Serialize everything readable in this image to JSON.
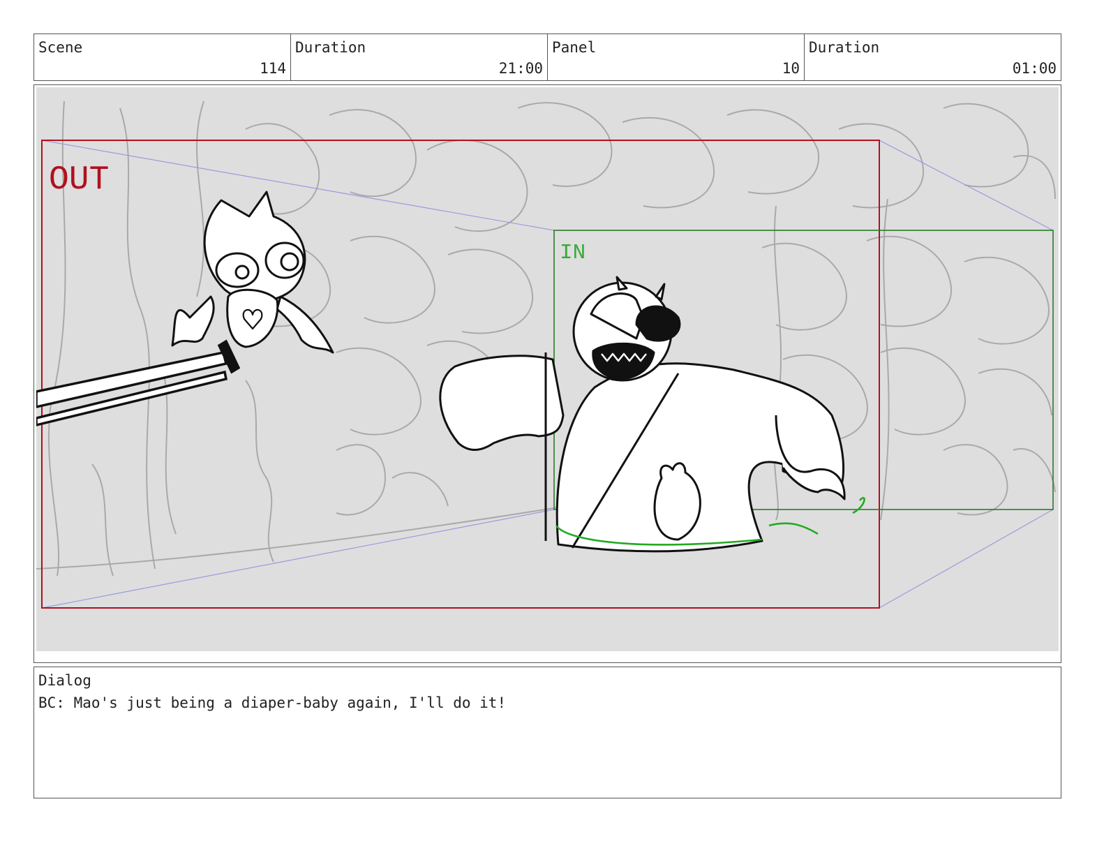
{
  "header": {
    "scene_label": "Scene",
    "scene_value": "114",
    "scene_duration_label": "Duration",
    "scene_duration_value": "21:00",
    "panel_label": "Panel",
    "panel_value": "10",
    "panel_duration_label": "Duration",
    "panel_duration_value": "01:00"
  },
  "frame": {
    "out_label": "OUT",
    "in_label": "IN",
    "out_color": "#b01020",
    "in_color": "#2a8a2a",
    "guide_color": "#9a9ae0",
    "background_color": "#dedede"
  },
  "dialog": {
    "label": "Dialog",
    "text": "BC: Mao's just being a diaper-baby again, I'll do it!"
  }
}
